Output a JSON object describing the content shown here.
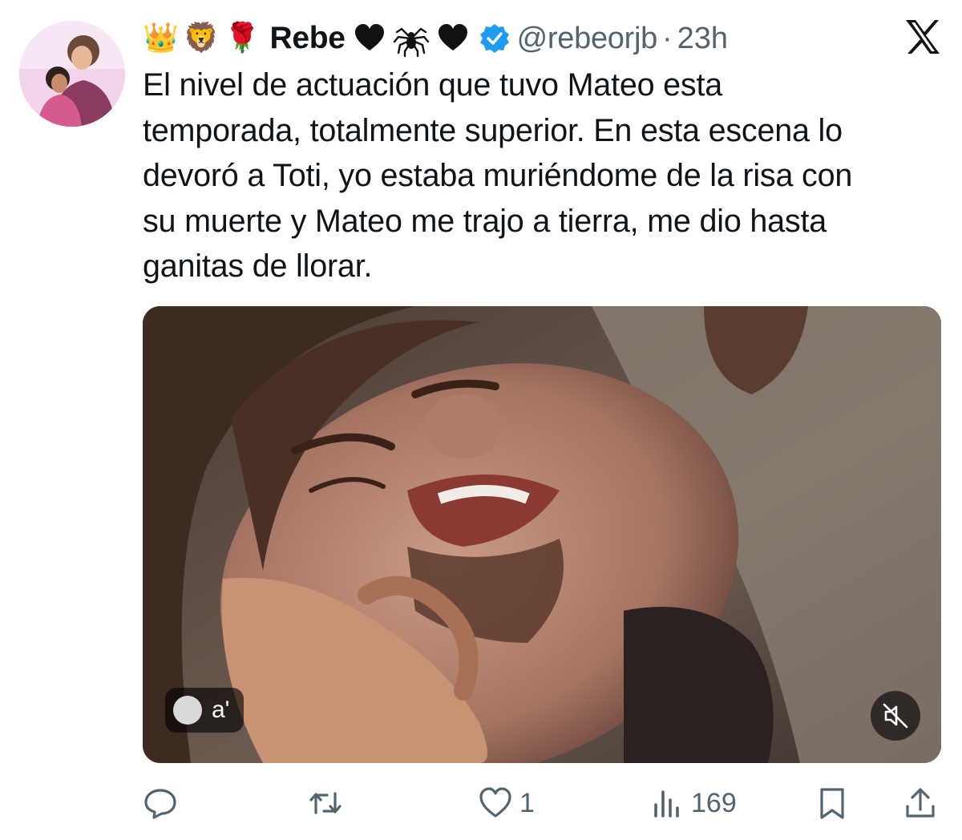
{
  "author": {
    "emojis_before": [
      "👑",
      "🦁",
      "🌹"
    ],
    "display_name": "Rebe",
    "emoji_icons_after": [
      "black-heart-icon",
      "spider-icon",
      "black-heart-icon"
    ],
    "handle": "@rebeorjb",
    "separator": "·",
    "time": "23h",
    "verified": true
  },
  "platform": {
    "logo": "x-logo-icon"
  },
  "tweet": {
    "text": "El nivel de actuación que tuvo Mateo esta\ntemporada, totalmente superior. En esta escena lo\ndevoró a Toti, yo estaba muriéndome de la risa con\nsu muerte y Mateo me trajo a tierra, me dio hasta\nganitas de llorar."
  },
  "media": {
    "type": "video",
    "overlay_label": "a'",
    "muted": true
  },
  "actions": {
    "reply": {
      "icon": "reply-icon",
      "count": ""
    },
    "repost": {
      "icon": "repost-icon",
      "count": ""
    },
    "like": {
      "icon": "heart-outline-icon",
      "count": "1"
    },
    "views": {
      "icon": "views-icon",
      "count": "169"
    },
    "bookmark": {
      "icon": "bookmark-icon"
    },
    "share": {
      "icon": "share-icon"
    }
  },
  "colors": {
    "text": "#0f1419",
    "secondary": "#536471",
    "verified": "#1d9bf0"
  }
}
